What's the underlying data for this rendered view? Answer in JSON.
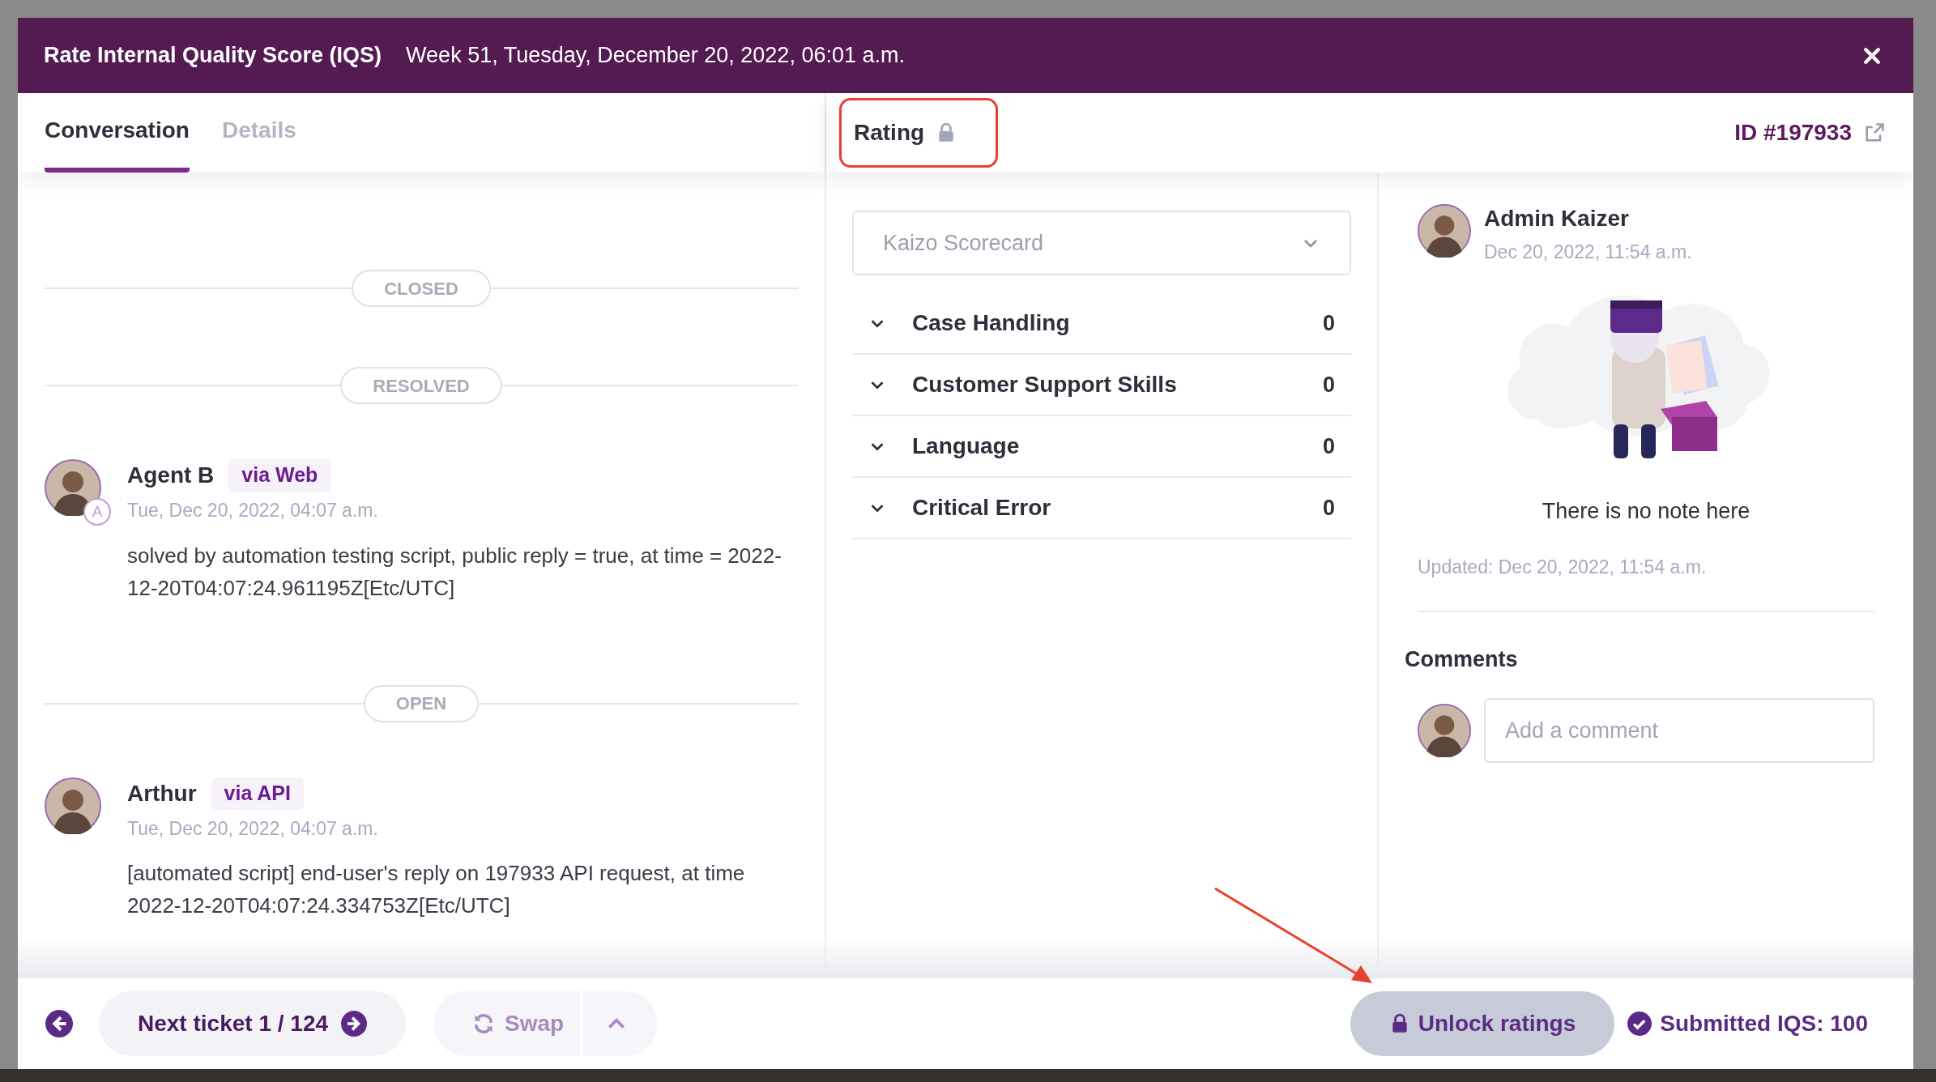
{
  "dialog": {
    "title": "Rate Internal Quality Score (IQS)",
    "subtitle": "Week 51, Tuesday, December 20, 2022, 06:01 a.m."
  },
  "conversation_tabs": [
    {
      "label": "Conversation",
      "selected": true
    },
    {
      "label": "Details",
      "selected": false
    }
  ],
  "timeline": [
    {
      "kind": "status",
      "label": "CLOSED"
    },
    {
      "kind": "status",
      "label": "RESOLVED"
    },
    {
      "kind": "message",
      "author": "Agent B",
      "channel": "via Web",
      "agent_badge": "A",
      "time": "Tue, Dec 20, 2022, 04:07 a.m.",
      "body": "solved by automation testing script, public reply = true, at time = 2022-12-20T04:07:24.961195Z[Etc/UTC]"
    },
    {
      "kind": "status",
      "label": "OPEN"
    },
    {
      "kind": "message",
      "author": "Arthur",
      "channel": "via API",
      "time": "Tue, Dec 20, 2022, 04:07 a.m.",
      "body": "[automated script] end-user's reply on 197933 API request, at time 2022-12-20T04:07:24.334753Z[Etc/UTC]"
    }
  ],
  "rating": {
    "title": "Rating",
    "locked": true,
    "ticket_id": "ID #197933",
    "scorecard": "Kaizo Scorecard",
    "categories": [
      {
        "name": "Case Handling",
        "score": "0"
      },
      {
        "name": "Customer Support Skills",
        "score": "0"
      },
      {
        "name": "Language",
        "score": "0"
      },
      {
        "name": "Critical Error",
        "score": "0"
      }
    ]
  },
  "note": {
    "author": "Admin Kaizer",
    "time": "Dec 20, 2022, 11:54 a.m.",
    "empty_text": "There is no note here",
    "updated": "Updated: Dec 20, 2022, 11:54 a.m."
  },
  "comments": {
    "title": "Comments",
    "placeholder": "Add a comment"
  },
  "footer": {
    "next": "Next ticket 1 / 124",
    "swap": "Swap",
    "unlock": "Unlock ratings",
    "submitted": "Submitted IQS: 100"
  }
}
